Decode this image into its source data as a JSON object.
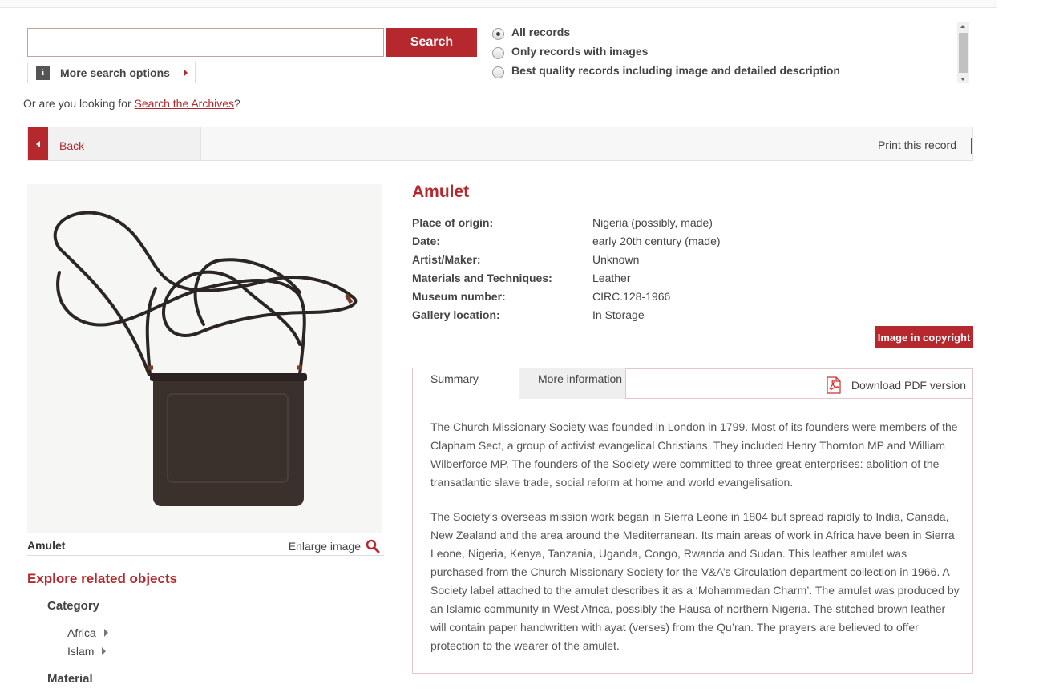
{
  "search": {
    "button_label": "Search",
    "input_value": "",
    "more_options_label": "More search options",
    "info_icon_glyph": "i",
    "radio_options": [
      {
        "label": "All records",
        "checked": true
      },
      {
        "label": "Only records with images",
        "checked": false
      },
      {
        "label": "Best quality records including image and detailed description",
        "checked": false
      }
    ]
  },
  "archives": {
    "prefix": "Or are you looking for ",
    "link": "Search the Archives",
    "suffix": "?"
  },
  "nav": {
    "back_label": "Back",
    "print_label": "Print this record"
  },
  "object": {
    "caption_title": "Amulet",
    "enlarge_label": "Enlarge image",
    "title": "Amulet",
    "details": [
      {
        "label": "Place of origin:",
        "value": "Nigeria (possibly, made)"
      },
      {
        "label": "Date:",
        "value": "early 20th century (made)"
      },
      {
        "label": "Artist/Maker:",
        "value": "Unknown"
      },
      {
        "label": "Materials and Techniques:",
        "value": "Leather"
      },
      {
        "label": "Museum number:",
        "value": "CIRC.128-1966"
      },
      {
        "label": "Gallery location:",
        "value": "In Storage"
      }
    ],
    "copyright_label": "Image in copyright"
  },
  "explore": {
    "heading": "Explore related objects",
    "category_heading": "Category",
    "categories": [
      "Africa",
      "Islam"
    ],
    "material_heading": "Material"
  },
  "tabs": {
    "summary_label": "Summary",
    "more_info_label": "More information",
    "pdf_label": "Download PDF version"
  },
  "summary": {
    "paragraphs": [
      "The Church Missionary Society was founded in London in 1799. Most of its founders were members of the Clapham Sect, a group of activist evangelical Christians. They included Henry Thornton MP and William Wilberforce MP. The founders of the Society were committed to three great enterprises: abolition of the transatlantic slave trade, social reform at home and world evangelisation.",
      "The Society’s overseas mission work began in Sierra Leone in 1804 but spread rapidly to India, Canada, New Zealand and the area around the Mediterranean. Its main areas of work in Africa have been in Sierra Leone, Nigeria, Kenya, Tanzania, Uganda, Congo, Rwanda and Sudan. This leather amulet was purchased from the Church Missionary Society for the V&A’s Circulation department collection in 1966. A Society label attached to the amulet describes it as a ‘Mohammedan Charm’. The amulet was produced by an Islamic community in West Africa, possibly the Hausa of northern Nigeria. The stitched brown leather will contain paper handwritten with ayat (verses) from the Qu’ran. The prayers are believed to offer protection to the wearer of the amulet."
    ]
  },
  "colors": {
    "accent": "#b5282e",
    "text": "#444444"
  },
  "icons": [
    "info-icon",
    "chevron-right-icon",
    "chevron-left-icon",
    "magnifier-icon",
    "pdf-icon"
  ]
}
